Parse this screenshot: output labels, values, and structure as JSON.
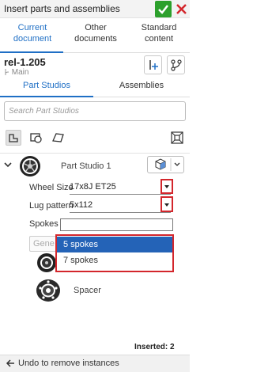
{
  "header": {
    "title": "Insert parts and assemblies"
  },
  "tabs": [
    {
      "label": "Current document",
      "line1": "Current",
      "line2": "document"
    },
    {
      "label": "Other documents",
      "line1": "Other",
      "line2": "documents"
    },
    {
      "label": "Standard content",
      "line1": "Standard",
      "line2": "content"
    }
  ],
  "document": {
    "name": "rel-1.205",
    "branch": "Main"
  },
  "section_tabs": [
    "Part Studios",
    "Assemblies"
  ],
  "search": {
    "placeholder": "Search Part Studios",
    "value": ""
  },
  "part_studio": {
    "name": "Part Studio 1",
    "fields": [
      {
        "label": "Wheel Size",
        "value": "17x8J ET25"
      },
      {
        "label": "Lug pattern",
        "value": "5x112"
      },
      {
        "label": "Spokes",
        "value": ""
      }
    ],
    "spokes_options": [
      "5 spokes",
      "7 spokes"
    ],
    "selected_option": "5 spokes",
    "generate_label": "Gene",
    "parts": [
      {
        "name": "Spacer"
      }
    ]
  },
  "footer": {
    "inserted_text": "Inserted: 2",
    "undo_label": "Undo to remove instances"
  },
  "colors": {
    "accent": "#1f6fc5",
    "confirm": "#2ca02c",
    "cancel": "#d3262c",
    "highlight": "#d3262c",
    "selection": "#2463b7"
  },
  "icons": [
    "check-icon",
    "close-icon",
    "insert-feature-icon",
    "branch-icon",
    "part-studio-icon",
    "part-icon",
    "surface-icon",
    "configure-icon",
    "chevron-down-icon",
    "wheel-thumbnail-icon",
    "spacer-thumbnail-icon",
    "undo-arrow-icon",
    "cube-icon"
  ]
}
